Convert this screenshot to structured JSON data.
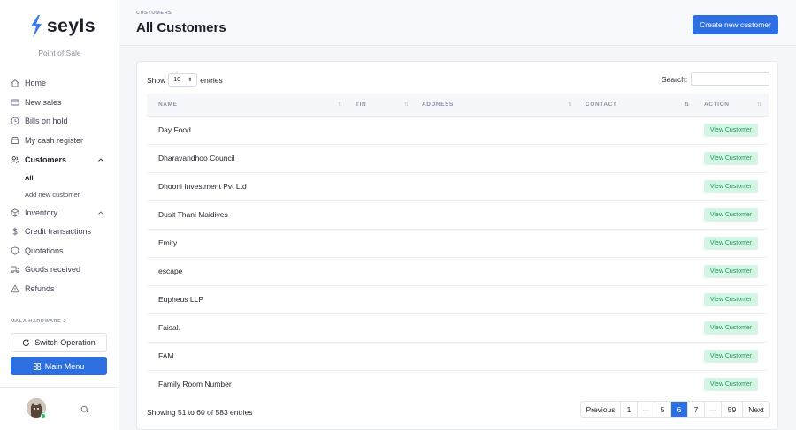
{
  "brand": {
    "name": "seyls",
    "subtitle": "Point of Sale"
  },
  "sidebar": {
    "items": [
      {
        "label": "Home",
        "icon": "home-icon"
      },
      {
        "label": "New sales",
        "icon": "card-icon"
      },
      {
        "label": "Bills on hold",
        "icon": "clock-icon"
      },
      {
        "label": "My cash register",
        "icon": "register-icon"
      },
      {
        "label": "Customers",
        "icon": "users-icon"
      },
      {
        "label": "Inventory",
        "icon": "box-icon"
      },
      {
        "label": "Credit transactions",
        "icon": "dollar-icon"
      },
      {
        "label": "Quotations",
        "icon": "shield-icon"
      },
      {
        "label": "Goods received",
        "icon": "truck-icon"
      },
      {
        "label": "Refunds",
        "icon": "warning-icon"
      }
    ],
    "customers_sub": [
      {
        "label": "All"
      },
      {
        "label": "Add new customer"
      }
    ],
    "store_label": "MALA HARDWARE 2",
    "switch_label": "Switch Operation",
    "main_menu_label": "Main Menu"
  },
  "header": {
    "breadcrumb": "CUSTOMERS",
    "title": "All Customers",
    "create_label": "Create new customer"
  },
  "table": {
    "show_label": "Show",
    "entries_value": "10",
    "entries_label": "entries",
    "search_label": "Search:",
    "search_value": "",
    "columns": [
      "NAME",
      "TIN",
      "ADDRESS",
      "CONTACT",
      "ACTION"
    ],
    "action_label": "View Customer",
    "rows": [
      {
        "name": "Day Food"
      },
      {
        "name": "Dharavandhoo Council"
      },
      {
        "name": "Dhooni Investment Pvt Ltd"
      },
      {
        "name": "Dusit Thani Maldives"
      },
      {
        "name": "Emity"
      },
      {
        "name": "escape"
      },
      {
        "name": "Eupheus LLP"
      },
      {
        "name": "Faisal."
      },
      {
        "name": "FAM"
      },
      {
        "name": "Family Room Number"
      }
    ],
    "info": "Showing 51 to 60 of 583 entries"
  },
  "pagination": {
    "prev": "Previous",
    "pages": [
      "1",
      "…",
      "5",
      "6",
      "7",
      "…",
      "59"
    ],
    "current": "6",
    "next": "Next"
  },
  "colors": {
    "primary": "#2d6fe0",
    "success_bg": "#d4f5e3",
    "success_text": "#1e9e5a"
  }
}
